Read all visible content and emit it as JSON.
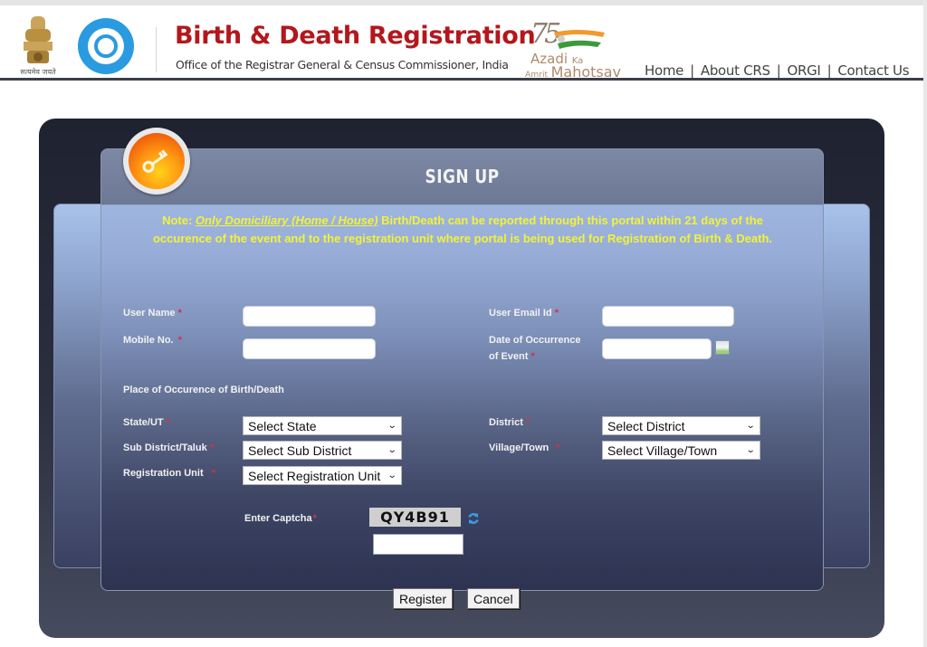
{
  "header": {
    "emblem_caption": "सत्यमेव जयते",
    "title": "Birth & Death Registration",
    "subtitle": "Office of the Registrar General & Census Commissioner, India",
    "campaign_logo": {
      "line1_main": "Azadi",
      "line1_small": "Ka",
      "line2_small": "Amrit",
      "line2_main": "Mahotsav",
      "number": "75"
    },
    "nav": [
      {
        "label": "Home"
      },
      {
        "label": "About CRS"
      },
      {
        "label": "ORGI"
      },
      {
        "label": "Contact Us"
      }
    ],
    "nav_separator": "|"
  },
  "form": {
    "title": "SIGN UP",
    "note": {
      "prefix": "Note: ",
      "emphasis": "Only Domiciliary (Home / House)",
      "text": " Birth/Death can be reported through this portal within 21 days of the occurence of the event and to the registration unit where portal is being used for Registration of Birth & Death."
    },
    "required_marker": "*",
    "fields": {
      "user_name": {
        "label": "User Name",
        "value": ""
      },
      "mobile": {
        "label": "Mobile No.",
        "value": ""
      },
      "email": {
        "label": "User Email Id",
        "value": ""
      },
      "date_label_line1": "Date of Occurrence",
      "date_label_line2": "of Event",
      "date_value": ""
    },
    "place_heading": "Place of Occurence of Birth/Death",
    "selects": {
      "state": {
        "label": "State/UT",
        "selected": "Select State"
      },
      "district": {
        "label": "District",
        "selected": "Select District"
      },
      "sub_district": {
        "label": "Sub District/Taluk",
        "selected": "Select Sub District"
      },
      "village": {
        "label": "Village/Town",
        "selected": "Select Village/Town"
      },
      "reg_unit": {
        "label": "Registration Unit",
        "selected": "Select Registration Unit"
      }
    },
    "captcha": {
      "label": "Enter Captcha",
      "code": "QY4B91",
      "value": ""
    },
    "buttons": {
      "register": "Register",
      "cancel": "Cancel"
    }
  },
  "colors": {
    "title_red": "#b3171c",
    "note_yellow": "#f2f23a",
    "required_red": "#d0333f",
    "panel_dark": "#1f2230"
  }
}
